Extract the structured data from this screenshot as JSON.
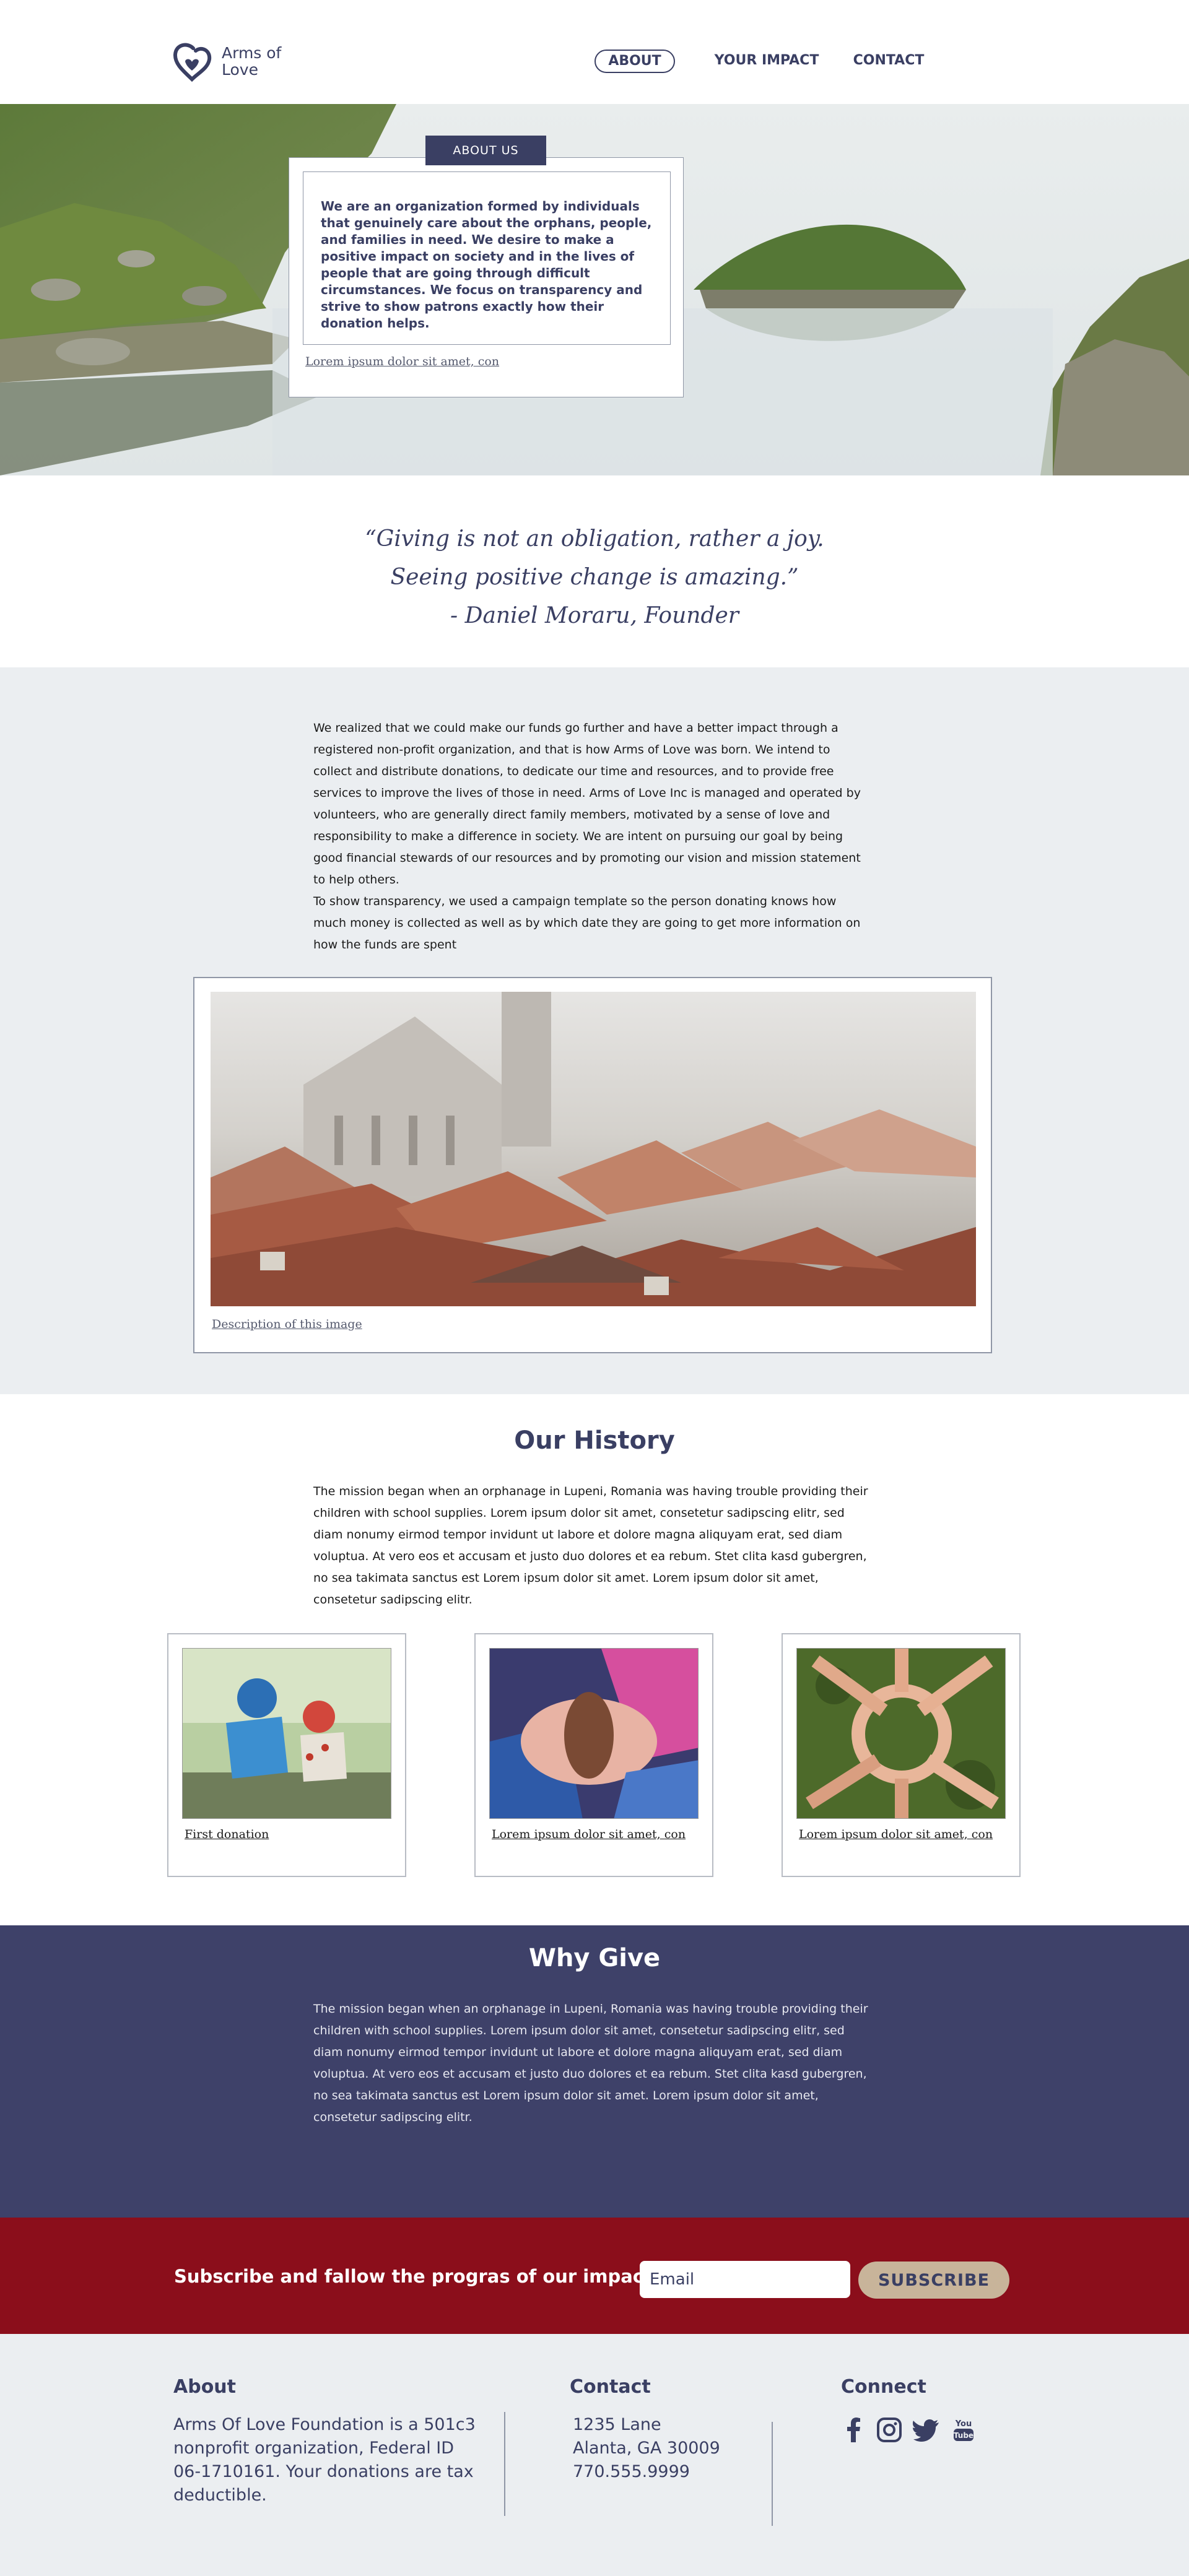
{
  "header": {
    "logo_text": "Arms of\nLove",
    "nav": [
      {
        "label": "ABOUT",
        "active": true
      },
      {
        "label": "YOUR IMPACT",
        "active": false
      },
      {
        "label": "CONTACT",
        "active": false
      }
    ]
  },
  "hero": {
    "tab_label": "ABOUT US",
    "text": "We are an organization formed by individuals that genuinely care about the orphans, people, and families in need. We desire to make a positive impact on society and in the lives of people that are going through difficult circumstances. We focus on transparency and strive to show patrons exactly how their donation helps.",
    "caption": "Lorem ipsum dolor sit amet, con"
  },
  "quote": {
    "text": "“Giving is not an obligation, rather a joy.\nSeeing positive change is amazing.”\n- Daniel Moraru, Founder"
  },
  "about": {
    "paragraph1": "We realized that we could make our funds go further and have a better impact through a registered non-profit organization, and that is how Arms of Love was born. We intend to collect and distribute donations, to dedicate our time and resources, and to provide free services to improve the lives of those in need. Arms of Love Inc is managed and operated by volunteers, who are generally direct family members, motivated by a sense of love and responsibility to make a difference in society. We are intent on pursuing our goal by being good financial stewards of our resources and by promoting our vision and mission statement to help others.",
    "paragraph2": "To show transparency, we used a campaign template so the person donating knows how much money is collected as well as by which date they are going to get more information on how the funds are spent",
    "image_caption": "Description of this image"
  },
  "history": {
    "title": "Our History",
    "paragraph": "The mission began when an orphanage in Lupeni, Romania was having trouble providing their children with school supplies. Lorem ipsum dolor sit amet, consetetur sadipscing elitr, sed diam nonumy eirmod tempor invidunt ut labore et dolore magna aliquyam erat, sed diam voluptua. At vero eos et accusam et justo duo dolores et ea rebum. Stet clita kasd gubergren, no sea takimata sanctus est Lorem ipsum dolor sit amet. Lorem ipsum dolor sit amet, consetetur sadipscing elitr.",
    "cards": [
      {
        "caption": "First donation"
      },
      {
        "caption": "Lorem ipsum dolor sit amet, con"
      },
      {
        "caption": "Lorem ipsum dolor sit amet, con"
      }
    ]
  },
  "why": {
    "title": "Why Give",
    "paragraph": "The mission began when an orphanage in Lupeni, Romania was having trouble providing their children with school supplies. Lorem ipsum dolor sit amet, consetetur sadipscing elitr, sed diam nonumy eirmod tempor invidunt ut labore et dolore magna aliquyam erat, sed diam voluptua. At vero eos et accusam et justo duo dolores et ea rebum. Stet clita kasd gubergren, no sea takimata sanctus est Lorem ipsum dolor sit amet. Lorem ipsum dolor sit amet, consetetur sadipscing elitr."
  },
  "subscribe": {
    "title": "Subscribe and fallow the progras of our impact",
    "email_placeholder": "Email",
    "button_label": "SUBSCRIBE"
  },
  "footer": {
    "about_heading": "About",
    "about_text": "Arms Of Love Foundation is a 501c3 nonprofit organization, Federal ID 06-1710161. Your donations are tax deductible.",
    "contact_heading": "Contact",
    "contact_text": "1235 Lane\nAlanta, GA 30009\n770.555.9999",
    "connect_heading": "Connect",
    "social_icons": [
      "facebook-icon",
      "instagram-icon",
      "twitter-icon",
      "youtube-icon"
    ]
  },
  "colors": {
    "brand_navy": "#3a3f63",
    "why_bg": "#3e4169",
    "subscribe_bg": "#8b0e1b",
    "subscribe_button": "#c8b49a",
    "light_bg": "#ebeef1"
  }
}
